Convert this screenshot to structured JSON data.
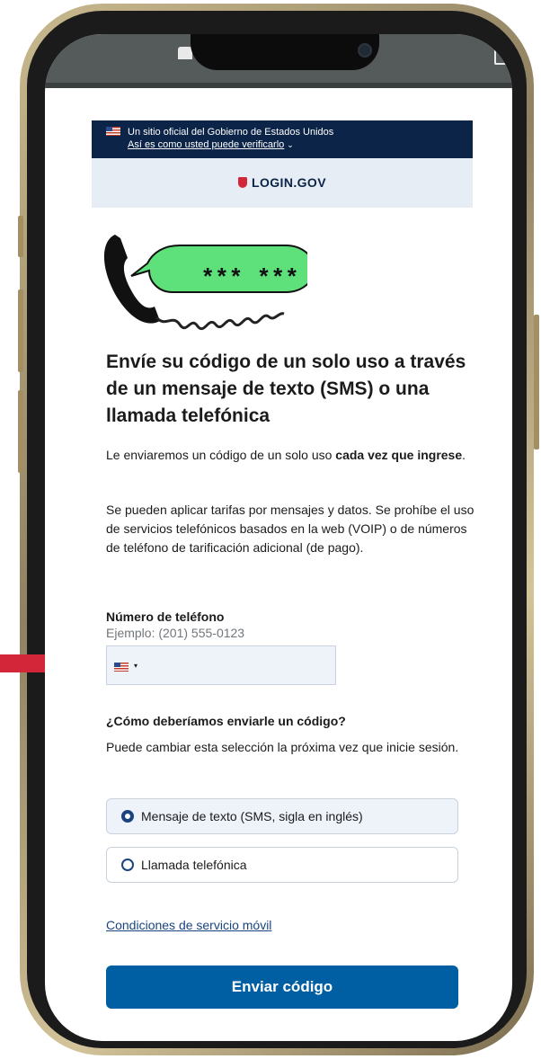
{
  "gov_banner": {
    "official_text": "Un sitio oficial del Gobierno de Estados Unidos",
    "verify_link": "Así es como usted puede verificarlo",
    "chevron_glyph": "⌄"
  },
  "header": {
    "logo_text": "LOGIN.GOV"
  },
  "illustration": {
    "code_text": "*** ***"
  },
  "main": {
    "title": "Envíe su código de un solo uso a través de un mensaje de texto (SMS) o una llamada telefónica",
    "intro_prefix": "Le enviaremos un código de un solo uso ",
    "intro_bold": "cada vez que ingrese",
    "intro_suffix": ".",
    "rates_text": "Se pueden aplicar tarifas por mensajes y datos. Se prohíbe el uso de servicios telefónicos basados en la web (VOIP) o de números de teléfono de tarificación adicional (de pago)."
  },
  "phone_field": {
    "label": "Número de teléfono",
    "hint": "Ejemplo: (201) 555-0123",
    "country_caret": "▾",
    "value": ""
  },
  "delivery": {
    "question": "¿Cómo deberíamos enviarle un código?",
    "help": "Puede cambiar esta selección la próxima vez que inicie sesión.",
    "options": [
      {
        "label": "Mensaje de texto (SMS, sigla en inglés)",
        "selected": true
      },
      {
        "label": "Llamada telefónica",
        "selected": false
      }
    ]
  },
  "terms_link": "Condiciones de servicio móvil",
  "submit_button": "Enviar código",
  "colors": {
    "banner_bg": "#0b2447",
    "primary_button": "#005ea2",
    "speech_bubble": "#5ee07a",
    "accent_red": "#d32638"
  }
}
